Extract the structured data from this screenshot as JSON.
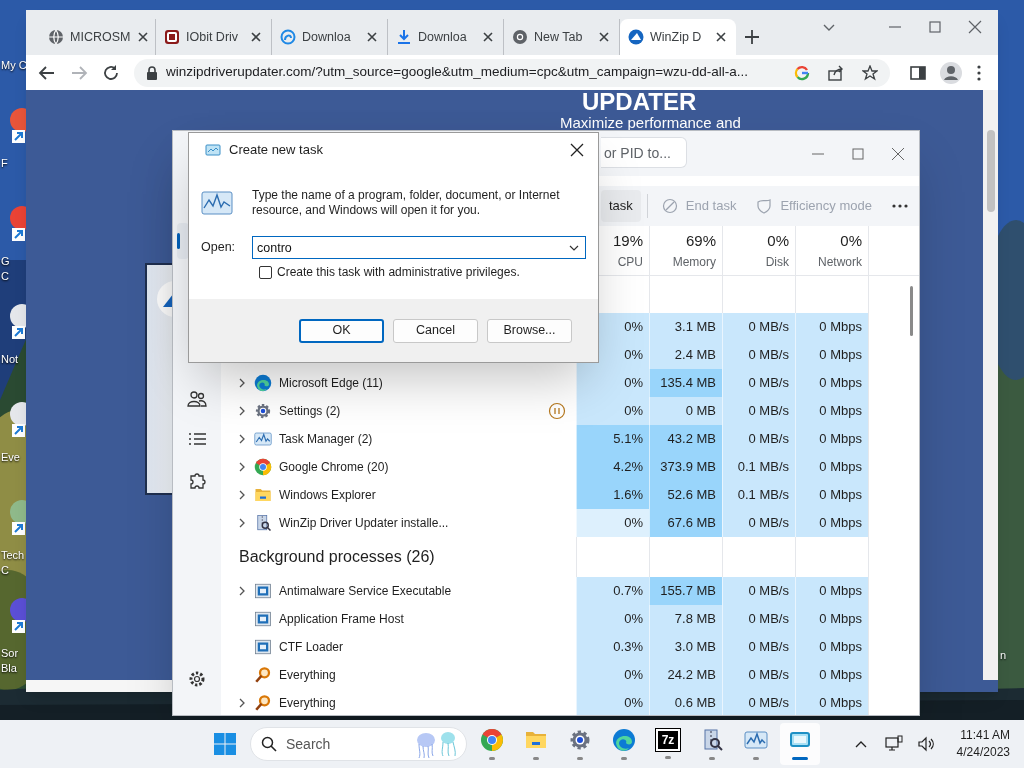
{
  "desktop": {
    "icons": [
      {
        "kind": "computer",
        "lines": [
          "My C"
        ]
      },
      {
        "kind": "shortcut",
        "lines": [
          "F"
        ]
      },
      {
        "kind": "shortcut",
        "lines": [
          "G",
          "C"
        ]
      },
      {
        "kind": "shortcut",
        "lines": [
          "Not"
        ]
      },
      {
        "kind": "shortcut",
        "lines": [
          "Eve"
        ]
      },
      {
        "kind": "shortcut",
        "lines": [
          "Tech",
          "C"
        ]
      },
      {
        "kind": "shortcut",
        "lines": [
          "Sor",
          "Bla"
        ]
      }
    ],
    "right_label": "n"
  },
  "browser": {
    "tabs": [
      {
        "title": "MICROSM",
        "selected": false
      },
      {
        "title": "IObit Driv",
        "selected": false
      },
      {
        "title": "Downloa",
        "selected": false
      },
      {
        "title": "Downloa",
        "selected": false
      },
      {
        "title": "New Tab",
        "selected": false
      },
      {
        "title": "WinZip D",
        "selected": true
      }
    ],
    "url": "winzipdriverupdater.com/?utm_source=google&utm_medium=cpc&utm_campaign=wzu-dd-all-a...",
    "page": {
      "heading": "UPDATER",
      "subheading": "Maximize performance and"
    }
  },
  "task_manager": {
    "search": {
      "placeholder": "or PID to..."
    },
    "nav": [
      {
        "kind": "processes",
        "selected": true
      },
      {
        "kind": "users",
        "selected": false
      },
      {
        "kind": "details",
        "selected": false
      },
      {
        "kind": "services",
        "selected": false
      }
    ],
    "toolbar": [
      {
        "label": "task",
        "disabled": false
      },
      {
        "label": "End task",
        "disabled": true
      },
      {
        "label": "Efficiency mode",
        "disabled": true
      }
    ],
    "columns": [
      {
        "percent": "19%",
        "label": "CPU"
      },
      {
        "percent": "69%",
        "label": "Memory"
      },
      {
        "percent": "0%",
        "label": "Disk"
      },
      {
        "percent": "0%",
        "label": "Network"
      }
    ],
    "rows": [
      {
        "kind": "process",
        "cells": [
          {
            "text": "0%",
            "color": "#c9e7fc"
          },
          {
            "text": "3.1 MB",
            "color": "#c9e7fc"
          },
          {
            "text": "0 MB/s",
            "color": "#c9e7fc"
          },
          {
            "text": "0 Mbps",
            "color": "#c9e7fc"
          }
        ]
      },
      {
        "kind": "process",
        "cells": [
          {
            "text": "0%",
            "color": "#c9e7fc"
          },
          {
            "text": "2.4 MB",
            "color": "#c9e7fc"
          },
          {
            "text": "0 MB/s",
            "color": "#c9e7fc"
          },
          {
            "text": "0 Mbps",
            "color": "#c9e7fc"
          }
        ]
      },
      {
        "kind": "process",
        "name": "Microsoft Edge (11)",
        "expandable": true,
        "paused": false,
        "cells": [
          {
            "text": "0%",
            "color": "#c9e7fc"
          },
          {
            "text": "135.4 MB",
            "color": "#99d5fb"
          },
          {
            "text": "0 MB/s",
            "color": "#c9e7fc"
          },
          {
            "text": "0 Mbps",
            "color": "#c9e7fc"
          }
        ]
      },
      {
        "kind": "process",
        "name": "Settings (2)",
        "expandable": true,
        "paused": true,
        "cells": [
          {
            "text": "0%",
            "color": "#c9e7fc"
          },
          {
            "text": "0 MB",
            "color": "#c9e7fc"
          },
          {
            "text": "0 MB/s",
            "color": "#c9e7fc"
          },
          {
            "text": "0 Mbps",
            "color": "#c9e7fc"
          }
        ]
      },
      {
        "kind": "process",
        "name": "Task Manager (2)",
        "expandable": true,
        "paused": false,
        "cells": [
          {
            "text": "5.1%",
            "color": "#99d5fb"
          },
          {
            "text": "43.2 MB",
            "color": "#99d5fb"
          },
          {
            "text": "0 MB/s",
            "color": "#c9e7fc"
          },
          {
            "text": "0 Mbps",
            "color": "#c9e7fc"
          }
        ]
      },
      {
        "kind": "process",
        "name": "Google Chrome (20)",
        "expandable": true,
        "paused": false,
        "cells": [
          {
            "text": "4.2%",
            "color": "#99d5fb"
          },
          {
            "text": "373.9 MB",
            "color": "#99d5fb"
          },
          {
            "text": "0.1 MB/s",
            "color": "#c9e7fc"
          },
          {
            "text": "0 Mbps",
            "color": "#c9e7fc"
          }
        ]
      },
      {
        "kind": "process",
        "name": "Windows Explorer",
        "expandable": true,
        "paused": false,
        "cells": [
          {
            "text": "1.6%",
            "color": "#99d5fb"
          },
          {
            "text": "52.6 MB",
            "color": "#99d5fb"
          },
          {
            "text": "0.1 MB/s",
            "color": "#c9e7fc"
          },
          {
            "text": "0 Mbps",
            "color": "#c9e7fc"
          }
        ]
      },
      {
        "kind": "process",
        "name": "WinZip Driver Updater installe...",
        "expandable": true,
        "paused": false,
        "cells": [
          {
            "text": "0%",
            "color": "#ddf0fd"
          },
          {
            "text": "67.6 MB",
            "color": "#99d5fb"
          },
          {
            "text": "0 MB/s",
            "color": "#c9e7fc"
          },
          {
            "text": "0 Mbps",
            "color": "#c9e7fc"
          }
        ]
      },
      {
        "kind": "section",
        "name": "Background processes (26)"
      },
      {
        "kind": "process",
        "name": "Antimalware Service Executable",
        "expandable": true,
        "paused": false,
        "cells": [
          {
            "text": "0.7%",
            "color": "#c9e7fc"
          },
          {
            "text": "155.7 MB",
            "color": "#99d5fb"
          },
          {
            "text": "0 MB/s",
            "color": "#c9e7fc"
          },
          {
            "text": "0 Mbps",
            "color": "#c9e7fc"
          }
        ]
      },
      {
        "kind": "process",
        "name": "Application Frame Host",
        "expandable": false,
        "paused": false,
        "cells": [
          {
            "text": "0%",
            "color": "#c9e7fc"
          },
          {
            "text": "7.8 MB",
            "color": "#c9e7fc"
          },
          {
            "text": "0 MB/s",
            "color": "#c9e7fc"
          },
          {
            "text": "0 Mbps",
            "color": "#c9e7fc"
          }
        ]
      },
      {
        "kind": "process",
        "name": "CTF Loader",
        "expandable": false,
        "paused": false,
        "cells": [
          {
            "text": "0.3%",
            "color": "#c9e7fc"
          },
          {
            "text": "3.0 MB",
            "color": "#c9e7fc"
          },
          {
            "text": "0 MB/s",
            "color": "#c9e7fc"
          },
          {
            "text": "0 Mbps",
            "color": "#c9e7fc"
          }
        ]
      },
      {
        "kind": "process",
        "name": "Everything",
        "expandable": false,
        "paused": false,
        "cells": [
          {
            "text": "0%",
            "color": "#c9e7fc"
          },
          {
            "text": "24.2 MB",
            "color": "#c9e7fc"
          },
          {
            "text": "0 MB/s",
            "color": "#c9e7fc"
          },
          {
            "text": "0 Mbps",
            "color": "#c9e7fc"
          }
        ]
      },
      {
        "kind": "process",
        "name": "Everything",
        "expandable": true,
        "paused": false,
        "cells": [
          {
            "text": "0%",
            "color": "#c9e7fc"
          },
          {
            "text": "0.6 MB",
            "color": "#c9e7fc"
          },
          {
            "text": "0 MB/s",
            "color": "#c9e7fc"
          },
          {
            "text": "0 Mbps",
            "color": "#c9e7fc"
          }
        ]
      }
    ]
  },
  "dialog": {
    "title": "Create new task",
    "message": "Type the name of a program, folder, document, or Internet resource, and Windows will open it for you.",
    "open_label": "Open:",
    "value": "contro",
    "checkbox": {
      "label": "Create this task with administrative privileges.",
      "checked": false
    },
    "buttons": [
      {
        "label": "OK",
        "default": true
      },
      {
        "label": "Cancel",
        "default": false
      },
      {
        "label": "Browse...",
        "default": false
      }
    ]
  },
  "taskbar": {
    "search_label": "Search",
    "apps": [
      {
        "kind": "chrome",
        "active": false
      },
      {
        "kind": "folder",
        "active": false
      },
      {
        "kind": "gear",
        "active": false
      },
      {
        "kind": "edge",
        "active": false
      },
      {
        "kind": "archiver",
        "label": "7z",
        "active": false
      },
      {
        "kind": "installer",
        "active": false
      },
      {
        "kind": "monitor",
        "active": false
      },
      {
        "kind": "window",
        "active": true
      }
    ],
    "time": "11:41 AM",
    "date": "4/24/2023"
  }
}
